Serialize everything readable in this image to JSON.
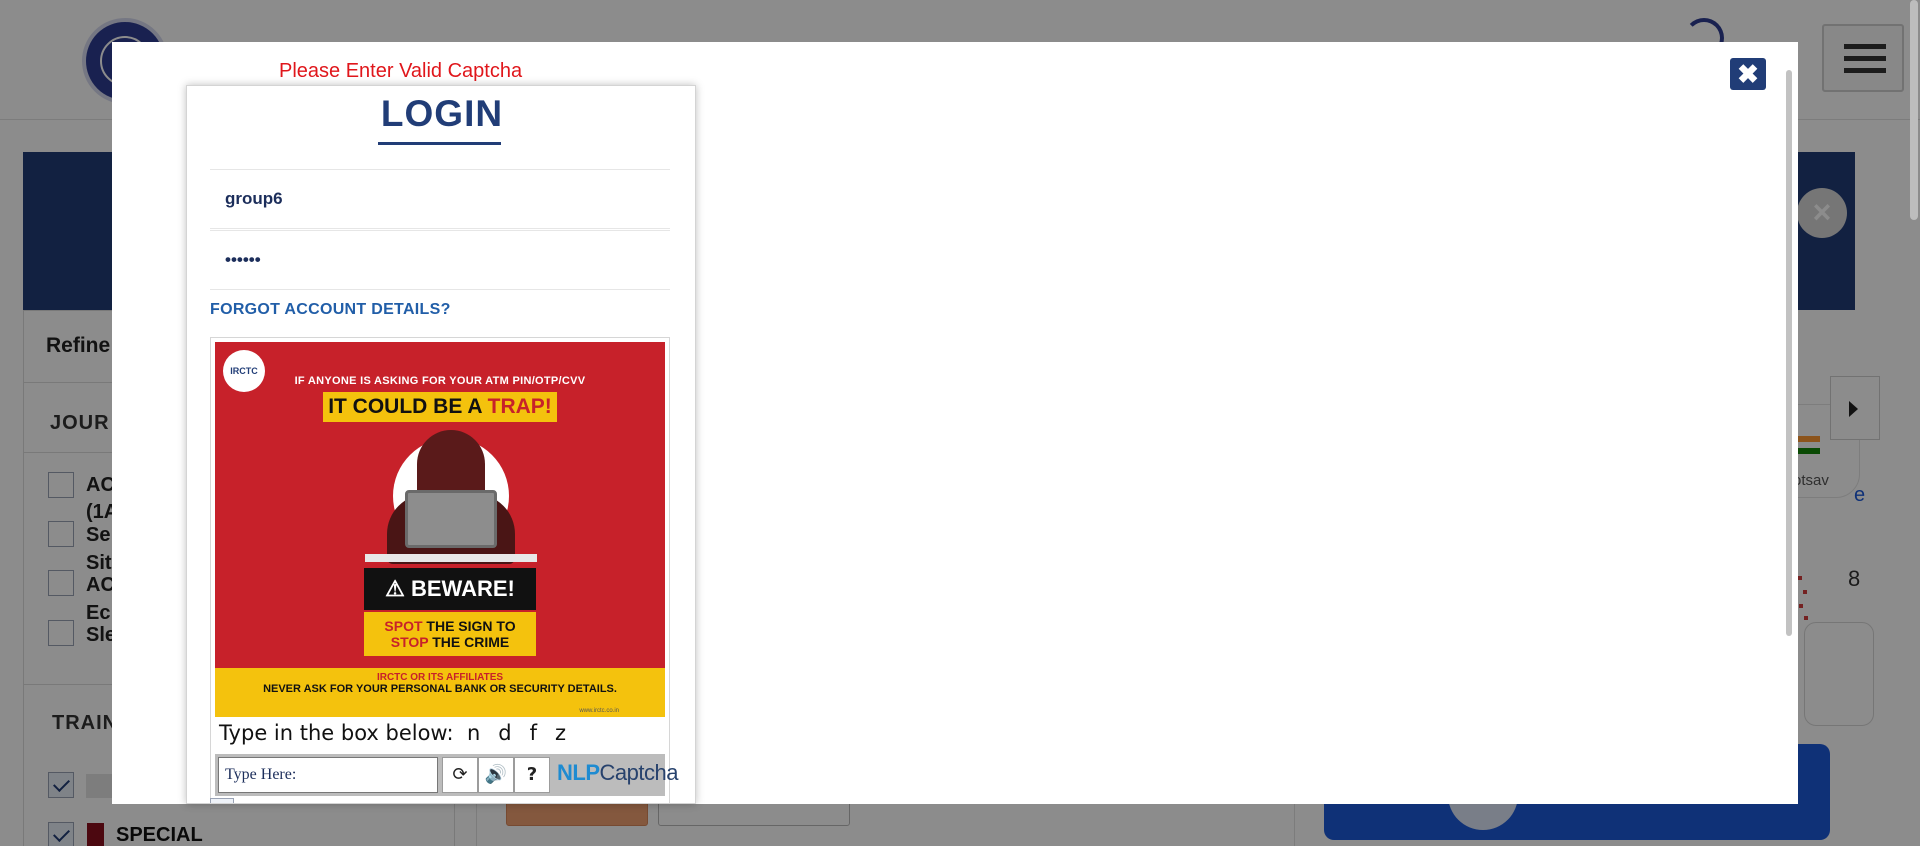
{
  "background": {
    "sidebar": {
      "refine_label": "Refine",
      "journey_label": "JOUR",
      "class_items": [
        {
          "text": "AC",
          "checked": false
        },
        {
          "text": "(1A",
          "checked": false
        },
        {
          "text": "Se",
          "checked": false
        },
        {
          "text": "Sit",
          "checked": false
        },
        {
          "text": "AC",
          "checked": false
        },
        {
          "text": "Ec",
          "checked": false
        },
        {
          "text": "Sle",
          "checked": false
        }
      ],
      "train_label": "TRAIN",
      "special_label": "SPECIAL",
      "special_color": "#8a0f1e"
    },
    "right": {
      "utsav_text": "otsav",
      "e_text": "e",
      "number_text": "8"
    },
    "banner_color": "#213d77",
    "action_button_color": "#1d59d9"
  },
  "modal": {
    "close_icon": "close-icon",
    "error_message": "Please Enter Valid Captcha",
    "login": {
      "title": "LOGIN",
      "username_value": "group6",
      "password_value": "••••••",
      "forgot_link": "FORGOT ACCOUNT DETAILS?"
    },
    "ad": {
      "logo_text": "IRCTC",
      "line1": "IF ANYONE IS ASKING FOR YOUR ATM PIN/OTP/CVV",
      "headline_prefix": "IT COULD BE A",
      "headline_highlight": "TRAP!",
      "beware": "⚠ BEWARE!",
      "spot_word1": "SPOT",
      "spot_rest1": "THE SIGN TO",
      "spot_word2": "STOP",
      "spot_rest2": "THE CRIME",
      "footer_line1": "IRCTC OR ITS AFFILIATES",
      "footer_line2": "NEVER ASK FOR YOUR PERSONAL BANK OR SECURITY DETAILS.",
      "url": "www.irctc.co.in"
    },
    "captcha": {
      "instruction": "Type in the box below:",
      "letters": "ndfz",
      "input_placeholder": "Type Here:",
      "refresh_icon": "refresh-icon",
      "audio_icon": "audio-icon",
      "help_icon": "help-icon",
      "brand_nlp": "NLP",
      "brand_captcha": "Captcha"
    }
  },
  "colors": {
    "brand_navy": "#213d77",
    "error_red": "#e0161b",
    "link_blue": "#215ea8",
    "poster_red": "#c7212a",
    "poster_yellow": "#f4c20d"
  }
}
